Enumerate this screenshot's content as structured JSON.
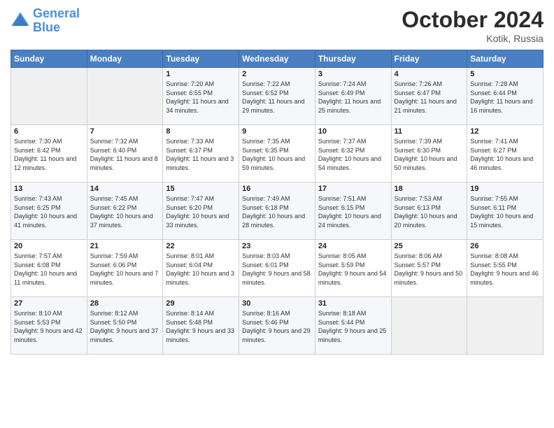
{
  "header": {
    "logo_line1": "General",
    "logo_line2": "Blue",
    "month": "October 2024",
    "location": "Kotik, Russia"
  },
  "weekdays": [
    "Sunday",
    "Monday",
    "Tuesday",
    "Wednesday",
    "Thursday",
    "Friday",
    "Saturday"
  ],
  "weeks": [
    [
      {
        "day": "",
        "sunrise": "",
        "sunset": "",
        "daylight": ""
      },
      {
        "day": "",
        "sunrise": "",
        "sunset": "",
        "daylight": ""
      },
      {
        "day": "1",
        "sunrise": "Sunrise: 7:20 AM",
        "sunset": "Sunset: 6:55 PM",
        "daylight": "Daylight: 11 hours and 34 minutes."
      },
      {
        "day": "2",
        "sunrise": "Sunrise: 7:22 AM",
        "sunset": "Sunset: 6:52 PM",
        "daylight": "Daylight: 11 hours and 29 minutes."
      },
      {
        "day": "3",
        "sunrise": "Sunrise: 7:24 AM",
        "sunset": "Sunset: 6:49 PM",
        "daylight": "Daylight: 11 hours and 25 minutes."
      },
      {
        "day": "4",
        "sunrise": "Sunrise: 7:26 AM",
        "sunset": "Sunset: 6:47 PM",
        "daylight": "Daylight: 11 hours and 21 minutes."
      },
      {
        "day": "5",
        "sunrise": "Sunrise: 7:28 AM",
        "sunset": "Sunset: 6:44 PM",
        "daylight": "Daylight: 11 hours and 16 minutes."
      }
    ],
    [
      {
        "day": "6",
        "sunrise": "Sunrise: 7:30 AM",
        "sunset": "Sunset: 6:42 PM",
        "daylight": "Daylight: 11 hours and 12 minutes."
      },
      {
        "day": "7",
        "sunrise": "Sunrise: 7:32 AM",
        "sunset": "Sunset: 6:40 PM",
        "daylight": "Daylight: 11 hours and 8 minutes."
      },
      {
        "day": "8",
        "sunrise": "Sunrise: 7:33 AM",
        "sunset": "Sunset: 6:37 PM",
        "daylight": "Daylight: 11 hours and 3 minutes."
      },
      {
        "day": "9",
        "sunrise": "Sunrise: 7:35 AM",
        "sunset": "Sunset: 6:35 PM",
        "daylight": "Daylight: 10 hours and 59 minutes."
      },
      {
        "day": "10",
        "sunrise": "Sunrise: 7:37 AM",
        "sunset": "Sunset: 6:32 PM",
        "daylight": "Daylight: 10 hours and 54 minutes."
      },
      {
        "day": "11",
        "sunrise": "Sunrise: 7:39 AM",
        "sunset": "Sunset: 6:30 PM",
        "daylight": "Daylight: 10 hours and 50 minutes."
      },
      {
        "day": "12",
        "sunrise": "Sunrise: 7:41 AM",
        "sunset": "Sunset: 6:27 PM",
        "daylight": "Daylight: 10 hours and 46 minutes."
      }
    ],
    [
      {
        "day": "13",
        "sunrise": "Sunrise: 7:43 AM",
        "sunset": "Sunset: 6:25 PM",
        "daylight": "Daylight: 10 hours and 41 minutes."
      },
      {
        "day": "14",
        "sunrise": "Sunrise: 7:45 AM",
        "sunset": "Sunset: 6:22 PM",
        "daylight": "Daylight: 10 hours and 37 minutes."
      },
      {
        "day": "15",
        "sunrise": "Sunrise: 7:47 AM",
        "sunset": "Sunset: 6:20 PM",
        "daylight": "Daylight: 10 hours and 33 minutes."
      },
      {
        "day": "16",
        "sunrise": "Sunrise: 7:49 AM",
        "sunset": "Sunset: 6:18 PM",
        "daylight": "Daylight: 10 hours and 28 minutes."
      },
      {
        "day": "17",
        "sunrise": "Sunrise: 7:51 AM",
        "sunset": "Sunset: 6:15 PM",
        "daylight": "Daylight: 10 hours and 24 minutes."
      },
      {
        "day": "18",
        "sunrise": "Sunrise: 7:53 AM",
        "sunset": "Sunset: 6:13 PM",
        "daylight": "Daylight: 10 hours and 20 minutes."
      },
      {
        "day": "19",
        "sunrise": "Sunrise: 7:55 AM",
        "sunset": "Sunset: 6:11 PM",
        "daylight": "Daylight: 10 hours and 15 minutes."
      }
    ],
    [
      {
        "day": "20",
        "sunrise": "Sunrise: 7:57 AM",
        "sunset": "Sunset: 6:08 PM",
        "daylight": "Daylight: 10 hours and 11 minutes."
      },
      {
        "day": "21",
        "sunrise": "Sunrise: 7:59 AM",
        "sunset": "Sunset: 6:06 PM",
        "daylight": "Daylight: 10 hours and 7 minutes."
      },
      {
        "day": "22",
        "sunrise": "Sunrise: 8:01 AM",
        "sunset": "Sunset: 6:04 PM",
        "daylight": "Daylight: 10 hours and 3 minutes."
      },
      {
        "day": "23",
        "sunrise": "Sunrise: 8:03 AM",
        "sunset": "Sunset: 6:01 PM",
        "daylight": "Daylight: 9 hours and 58 minutes."
      },
      {
        "day": "24",
        "sunrise": "Sunrise: 8:05 AM",
        "sunset": "Sunset: 5:59 PM",
        "daylight": "Daylight: 9 hours and 54 minutes."
      },
      {
        "day": "25",
        "sunrise": "Sunrise: 8:06 AM",
        "sunset": "Sunset: 5:57 PM",
        "daylight": "Daylight: 9 hours and 50 minutes."
      },
      {
        "day": "26",
        "sunrise": "Sunrise: 8:08 AM",
        "sunset": "Sunset: 5:55 PM",
        "daylight": "Daylight: 9 hours and 46 minutes."
      }
    ],
    [
      {
        "day": "27",
        "sunrise": "Sunrise: 8:10 AM",
        "sunset": "Sunset: 5:53 PM",
        "daylight": "Daylight: 9 hours and 42 minutes."
      },
      {
        "day": "28",
        "sunrise": "Sunrise: 8:12 AM",
        "sunset": "Sunset: 5:50 PM",
        "daylight": "Daylight: 9 hours and 37 minutes."
      },
      {
        "day": "29",
        "sunrise": "Sunrise: 8:14 AM",
        "sunset": "Sunset: 5:48 PM",
        "daylight": "Daylight: 9 hours and 33 minutes."
      },
      {
        "day": "30",
        "sunrise": "Sunrise: 8:16 AM",
        "sunset": "Sunset: 5:46 PM",
        "daylight": "Daylight: 9 hours and 29 minutes."
      },
      {
        "day": "31",
        "sunrise": "Sunrise: 8:18 AM",
        "sunset": "Sunset: 5:44 PM",
        "daylight": "Daylight: 9 hours and 25 minutes."
      },
      {
        "day": "",
        "sunrise": "",
        "sunset": "",
        "daylight": ""
      },
      {
        "day": "",
        "sunrise": "",
        "sunset": "",
        "daylight": ""
      }
    ]
  ]
}
